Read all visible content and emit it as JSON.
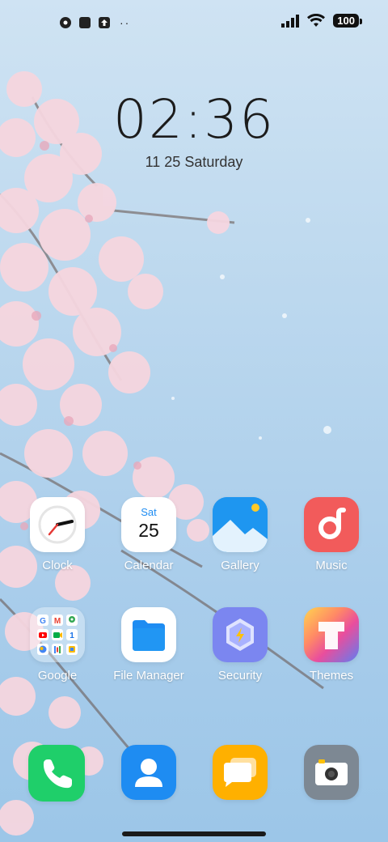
{
  "status_bar": {
    "left_icons": [
      "notification-app-icon",
      "notification-square-icon",
      "upload-icon"
    ],
    "overflow": "··",
    "battery": "100"
  },
  "clock": {
    "time": "02:36",
    "date": "11 25 Saturday"
  },
  "apps": [
    {
      "label": "Clock"
    },
    {
      "label": "Calendar",
      "weekday": "Sat",
      "day": "25"
    },
    {
      "label": "Gallery"
    },
    {
      "label": "Music"
    },
    {
      "label": "Google"
    },
    {
      "label": "File Manager"
    },
    {
      "label": "Security"
    },
    {
      "label": "Themes"
    }
  ],
  "dock": [
    {
      "icon": "phone-icon"
    },
    {
      "icon": "contacts-icon"
    },
    {
      "icon": "messages-icon"
    },
    {
      "icon": "camera-icon"
    }
  ],
  "colors": {
    "phone": "#1fcf6a",
    "contacts": "#1e8cf2",
    "messages": "#ffb000",
    "camera": "#7d8893",
    "music": "#f25b5b",
    "files": "#1e8cf2",
    "security": "#7b86f0"
  }
}
